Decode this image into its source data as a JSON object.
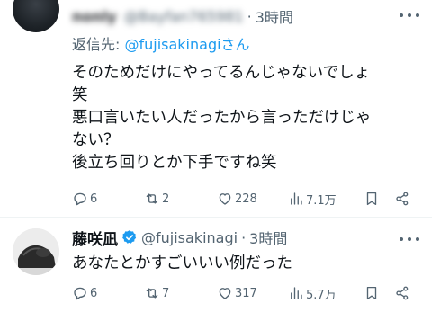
{
  "tweet1": {
    "name": "nonly",
    "handle": "@Bayfan765981",
    "dot": "·",
    "time": "3時間",
    "reply_prefix": "返信先: ",
    "reply_mention": "@fujisakinagiさん",
    "lines": [
      "そのためだけにやってるんじゃないでしょ",
      "笑",
      "悪口言いたい人だったから言っただけじゃ",
      "ない？",
      "後立ち回りとか下手ですね笑"
    ],
    "counts": {
      "replies": "6",
      "reposts": "2",
      "likes": "228",
      "views": "7.1万"
    }
  },
  "tweet2": {
    "name": "藤咲凪",
    "handle": "@fujisakinagi",
    "dot": "·",
    "time": "3時間",
    "text": "あなたとかすごいいい例だった",
    "verified": true,
    "counts": {
      "replies": "6",
      "reposts": "7",
      "likes": "317",
      "views": "5.7万"
    }
  },
  "colors": {
    "text": "#0f1419",
    "secondary": "#536471",
    "accent": "#1d9bf0"
  },
  "icons": [
    "reply-icon",
    "repost-icon",
    "like-icon",
    "views-icon",
    "bookmark-icon",
    "share-icon",
    "more-icon",
    "verified-badge-icon"
  ]
}
